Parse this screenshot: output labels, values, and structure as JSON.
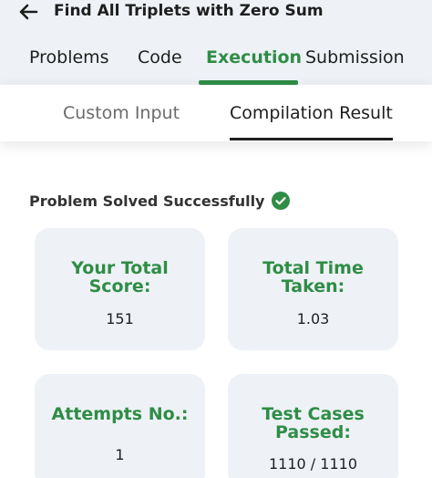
{
  "header": {
    "title": "Find All Triplets with Zero Sum"
  },
  "tabs": [
    {
      "label": "Problems"
    },
    {
      "label": "Code"
    },
    {
      "label": "Execution"
    },
    {
      "label": "Submission"
    }
  ],
  "subtabs": [
    {
      "label": "Custom Input"
    },
    {
      "label": "Compilation Result"
    }
  ],
  "status": {
    "text": "Problem Solved Successfully"
  },
  "cards": [
    {
      "label_line1": "Your Total",
      "label_line2": "Score:",
      "value": "151"
    },
    {
      "label_line1": "Total Time",
      "label_line2": "Taken:",
      "value": "1.03"
    },
    {
      "label_line1": "Attempts No.:",
      "value": "1"
    },
    {
      "label_line1": "Test Cases",
      "label_line2": "Passed:",
      "value": "1110 / 1110"
    }
  ],
  "colors": {
    "accent": "#2f8d46",
    "card_bg": "#eef2f6"
  },
  "icons": {
    "back": "arrow-left-icon",
    "status": "check-circle-icon"
  }
}
